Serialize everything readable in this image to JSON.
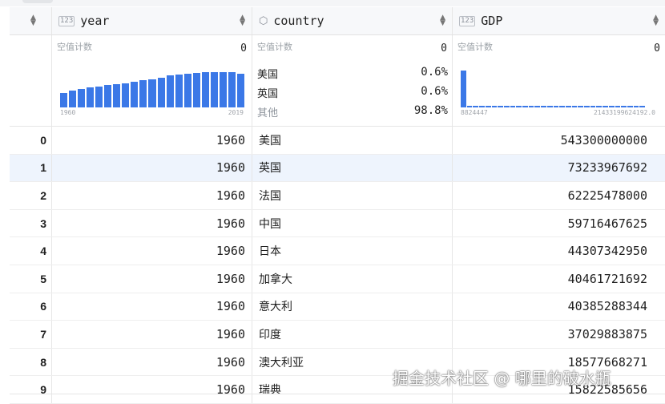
{
  "header": {
    "index_sort": "▲▼",
    "columns": [
      {
        "type_icon": "123",
        "name": "year"
      },
      {
        "type_icon": "Abc",
        "name": "country"
      },
      {
        "type_icon": "123",
        "name": "GDP"
      }
    ]
  },
  "stats": {
    "year": {
      "null_label": "空值计数",
      "null_count": "0",
      "hist_min": "1960",
      "hist_max": "2019",
      "histogram": [
        0.4,
        0.45,
        0.5,
        0.55,
        0.57,
        0.6,
        0.63,
        0.66,
        0.7,
        0.73,
        0.77,
        0.8,
        0.87,
        0.9,
        0.92,
        0.94,
        0.95,
        0.96,
        0.96,
        0.95,
        0.92
      ]
    },
    "country": {
      "null_label": "空值计数",
      "null_count": "0",
      "top": [
        {
          "name": "美国",
          "pct": "0.6%"
        },
        {
          "name": "英国",
          "pct": "0.6%"
        },
        {
          "name": "其他",
          "pct": "98.8%"
        }
      ]
    },
    "GDP": {
      "null_label": "空值计数",
      "null_count": "0",
      "hist_min": "8824447",
      "hist_max": "21433199624192.0",
      "histogram": [
        1.0,
        0.04,
        0.04,
        0.04,
        0.04,
        0.04,
        0.04,
        0.04,
        0.04,
        0.04,
        0.04,
        0.04,
        0.04,
        0.04,
        0.04,
        0.04,
        0.04,
        0.04,
        0.04,
        0.04,
        0.04,
        0.04,
        0.04,
        0.04,
        0.04,
        0.04,
        0.04,
        0.04,
        0.04,
        0.04
      ]
    }
  },
  "rows": [
    {
      "idx": "0",
      "year": "1960",
      "country": "美国",
      "gdp": "543300000000"
    },
    {
      "idx": "1",
      "year": "1960",
      "country": "英国",
      "gdp": "73233967692"
    },
    {
      "idx": "2",
      "year": "1960",
      "country": "法国",
      "gdp": "62225478000"
    },
    {
      "idx": "3",
      "year": "1960",
      "country": "中国",
      "gdp": "59716467625"
    },
    {
      "idx": "4",
      "year": "1960",
      "country": "日本",
      "gdp": "44307342950"
    },
    {
      "idx": "5",
      "year": "1960",
      "country": "加拿大",
      "gdp": "40461721692"
    },
    {
      "idx": "6",
      "year": "1960",
      "country": "意大利",
      "gdp": "40385288344"
    },
    {
      "idx": "7",
      "year": "1960",
      "country": "印度",
      "gdp": "37029883875"
    },
    {
      "idx": "8",
      "year": "1960",
      "country": "澳大利亚",
      "gdp": "18577668271"
    },
    {
      "idx": "9",
      "year": "1960",
      "country": "瑞典",
      "gdp": "15822585656"
    }
  ],
  "selected_row": 1,
  "watermark": "掘金技术社区 @ 哪里的破水瓶",
  "colors": {
    "bar": "#3b78e7",
    "selected_row": "#eef4fd"
  }
}
